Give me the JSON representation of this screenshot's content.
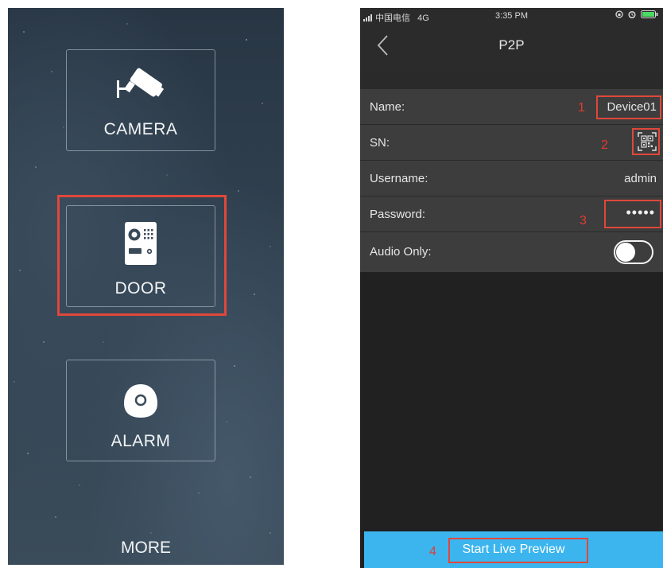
{
  "left_screen": {
    "tiles": [
      {
        "label": "CAMERA",
        "icon": "security-camera-icon"
      },
      {
        "label": "DOOR",
        "icon": "door-intercom-icon"
      },
      {
        "label": "ALARM",
        "icon": "alarm-sensor-icon"
      }
    ],
    "more_label": "MORE",
    "highlighted_tile": "DOOR",
    "highlight_color": "#e0473a"
  },
  "right_screen": {
    "status_bar": {
      "carrier": "中国电信",
      "network": "4G",
      "time": "3:35 PM"
    },
    "nav": {
      "title": "P2P",
      "back_icon": "chevron-left-icon"
    },
    "form": {
      "name_label": "Name:",
      "name_value": "Device01",
      "sn_label": "SN:",
      "sn_icon": "qr-scan-icon",
      "username_label": "Username:",
      "username_value": "admin",
      "password_label": "Password:",
      "password_value": "•••••",
      "audio_only_label": "Audio Only:",
      "audio_only_on": false
    },
    "start_button_label": "Start Live Preview",
    "annotations": [
      "1",
      "2",
      "3",
      "4"
    ],
    "annotation_color": "#e53a33",
    "accent_color": "#3cb5ee"
  }
}
